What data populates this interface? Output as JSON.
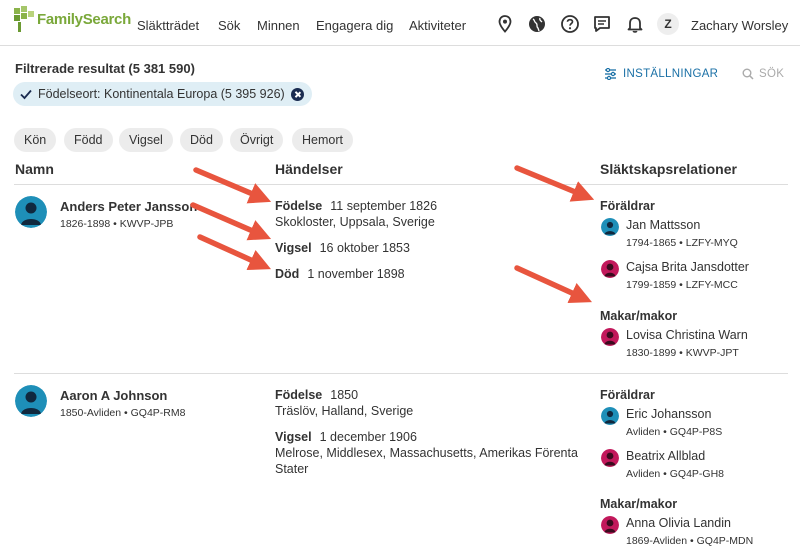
{
  "nav": {
    "logo_text": "FamilySearch",
    "items": [
      "Släktträdet",
      "Sök",
      "Minnen",
      "Engagera dig",
      "Aktiviteter"
    ],
    "avatar_letter": "Z",
    "user_name": "Zachary Worsley",
    "icons": [
      "location-pin-icon",
      "globe-icon",
      "help-icon",
      "chat-icon",
      "bell-icon"
    ]
  },
  "results": {
    "title": "Filtrerade resultat (5 381 590)",
    "filter_chip": "Födelseort: Kontinentala Europa (5 395 926)",
    "settings_label": "INSTÄLLNINGAR",
    "search_label": "SÖK",
    "facets": [
      "Kön",
      "Född",
      "Vigsel",
      "Död",
      "Övrigt",
      "Hemort"
    ]
  },
  "columns": {
    "name": "Namn",
    "events": "Händelser",
    "relations": "Släktskapsrelationer"
  },
  "records": [
    {
      "name": "Anders Peter Jansson",
      "meta": "1826-1898 •   KWVP-JPB",
      "gender": "male",
      "events": [
        {
          "label": "Födelse",
          "date": "11 september 1826",
          "place": "Skokloster, Uppsala, Sverige"
        },
        {
          "label": "Vigsel",
          "date": "16 oktober 1853",
          "place": ""
        },
        {
          "label": "Död",
          "date": "1 november 1898",
          "place": ""
        }
      ],
      "parents_label": "Föräldrar",
      "parents": [
        {
          "name": "Jan Mattsson",
          "meta": "1794-1865 •   LZFY-MYQ",
          "gender": "male"
        },
        {
          "name": "Cajsa Brita Jansdotter",
          "meta": "1799-1859 •   LZFY-MCC",
          "gender": "female"
        }
      ],
      "spouses_label": "Makar/makor",
      "spouses": [
        {
          "name": "Lovisa Christina Warn",
          "meta": "1830-1899 •   KWVP-JPT",
          "gender": "female"
        }
      ]
    },
    {
      "name": "Aaron A Johnson",
      "meta": "1850-Avliden •   GQ4P-RM8",
      "gender": "male",
      "events": [
        {
          "label": "Födelse",
          "date": "1850",
          "place": "Träslöv, Halland, Sverige"
        },
        {
          "label": "Vigsel",
          "date": "1 december 1906",
          "place": "Melrose, Middlesex, Massachusetts, Amerikas Förenta",
          "place2": "Stater"
        }
      ],
      "parents_label": "Föräldrar",
      "parents": [
        {
          "name": "Eric Johansson",
          "meta": "Avliden •   GQ4P-P8S",
          "gender": "male"
        },
        {
          "name": "Beatrix Allblad",
          "meta": "Avliden •   GQ4P-GH8",
          "gender": "female"
        }
      ],
      "spouses_label": "Makar/makor",
      "spouses": [
        {
          "name": "Anna Olivia Landin",
          "meta": "1869-Avliden •   GQ4P-MDN",
          "gender": "female"
        }
      ]
    }
  ],
  "colors": {
    "male_avatar": "#1e8fb8",
    "female_avatar": "#c2185b",
    "accent": "#1a70a6",
    "arrow": "#e8553e",
    "logo_green": "#7aa83a"
  }
}
